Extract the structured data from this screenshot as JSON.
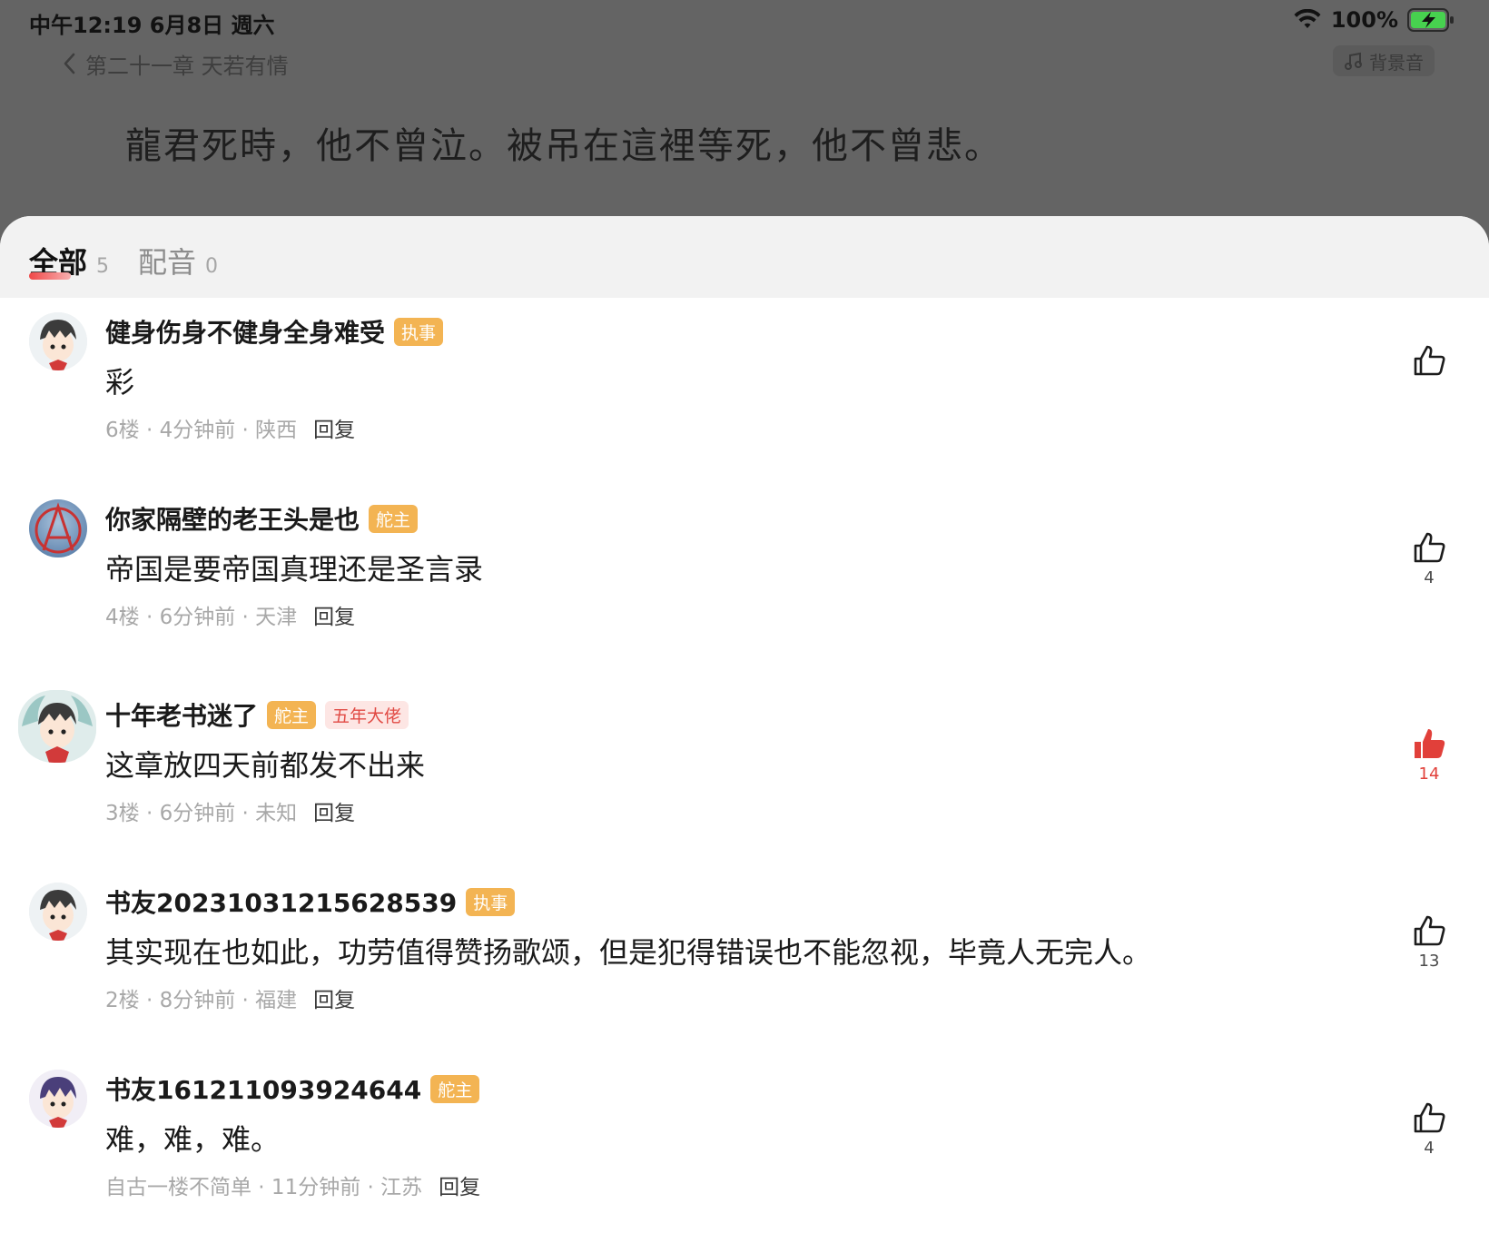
{
  "status_bar": {
    "time": "中午12:19   6月8日 週六",
    "battery": "100%",
    "wifi_icon": "wifi-icon",
    "battery_icon": "battery-charging-icon"
  },
  "reader": {
    "chapter_back_label": "第二十一章 天若有情",
    "background_sound_label": "背景音",
    "paragraph_text": "龍君死時，他不曾泣。被吊在這裡等死，他不曾悲。"
  },
  "tabs": [
    {
      "label": "全部",
      "count": "5",
      "active": true
    },
    {
      "label": "配音",
      "count": "0",
      "active": false
    }
  ],
  "colors": {
    "like_active": "#e1403a",
    "badge_orange": "#f3b453",
    "badge_red_text": "#e14b45"
  },
  "comments": [
    {
      "username": "健身伤身不健身全身难受",
      "badges": [
        "执事"
      ],
      "text": "彩",
      "meta": [
        "6楼 · 4分钟前 · 陕西"
      ],
      "reply_label": "回复",
      "likes": "",
      "liked": false
    },
    {
      "username": "你家隔壁的老王头是也",
      "badges": [
        "舵主"
      ],
      "text": "帝国是要帝国真理还是圣言录",
      "meta": [
        "4楼 · 6分钟前 · 天津"
      ],
      "reply_label": "回复",
      "likes": "4",
      "liked": false
    },
    {
      "username": "十年老书迷了",
      "badges": [
        "舵主",
        "五年大佬"
      ],
      "text": "这章放四天前都发不出来",
      "meta": [
        "3楼 · 6分钟前 · 未知"
      ],
      "reply_label": "回复",
      "likes": "14",
      "liked": true
    },
    {
      "username": "书友20231031215628539",
      "badges": [
        "执事"
      ],
      "text": "其实现在也如此，功劳值得赞扬歌颂，但是犯得错误也不能忽视，毕竟人无完人。",
      "meta": [
        "2楼 · 8分钟前 · 福建"
      ],
      "reply_label": "回复",
      "likes": "13",
      "liked": false
    },
    {
      "username": "书友161211093924644",
      "badges": [
        "舵主"
      ],
      "text": "难，难，难。",
      "meta": [
        "自古一楼不简单 · 11分钟前 · 江苏"
      ],
      "reply_label": "回复",
      "likes": "4",
      "liked": false
    }
  ]
}
